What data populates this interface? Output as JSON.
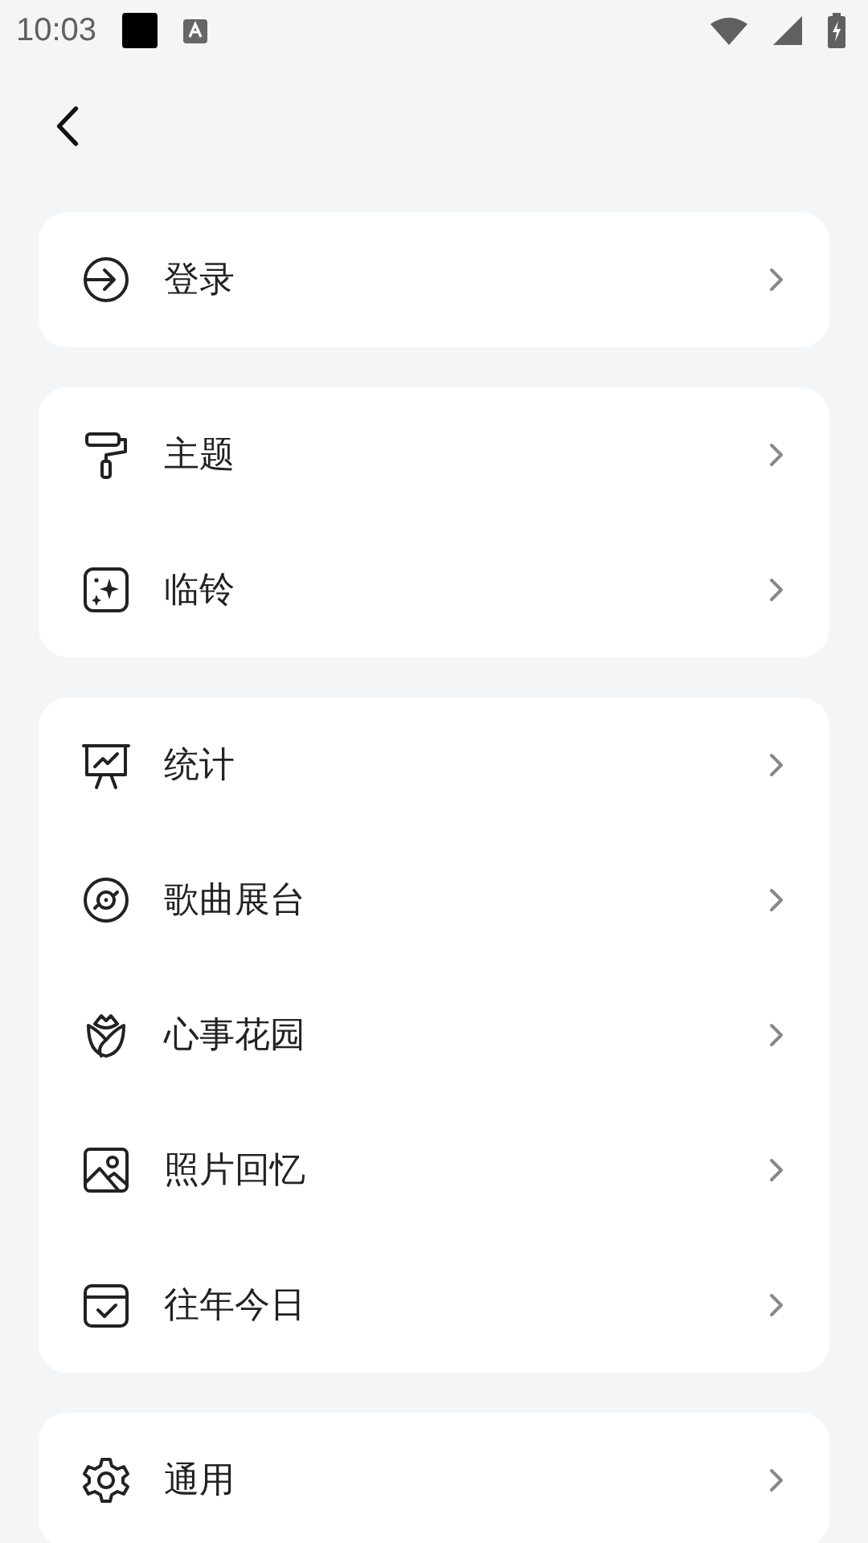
{
  "status_bar": {
    "time": "10:03"
  },
  "groups": [
    {
      "items": [
        {
          "label": "登录"
        }
      ]
    },
    {
      "items": [
        {
          "label": "主题"
        },
        {
          "label": "临铃"
        }
      ]
    },
    {
      "items": [
        {
          "label": "统计"
        },
        {
          "label": "歌曲展台"
        },
        {
          "label": "心事花园"
        },
        {
          "label": "照片回忆"
        },
        {
          "label": "往年今日"
        }
      ]
    },
    {
      "items": [
        {
          "label": "通用"
        }
      ]
    }
  ]
}
